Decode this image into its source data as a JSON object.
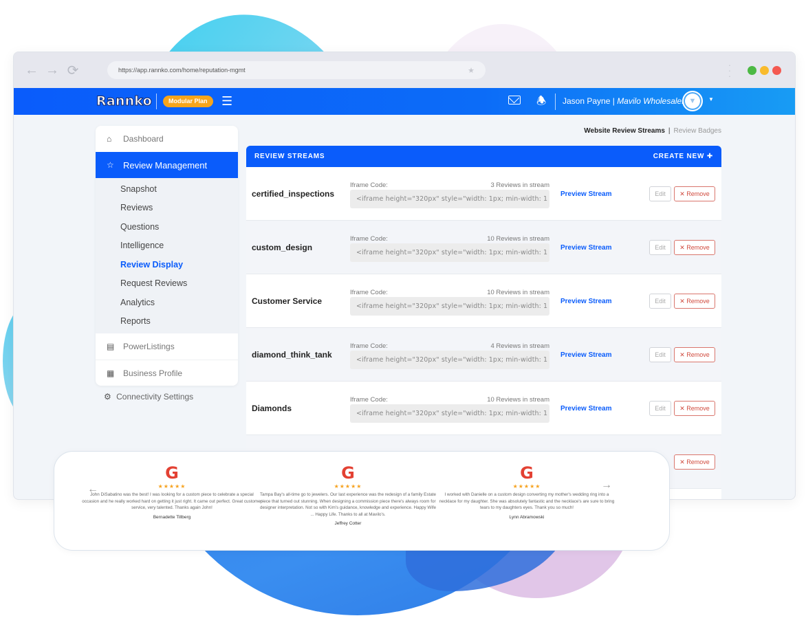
{
  "browser": {
    "url": "https://app.rannko.com/home/reputation-mgmt",
    "traffic_colors": [
      "#4cb944",
      "#f9bb2d",
      "#f45951"
    ]
  },
  "appbar": {
    "logo": "Rannko",
    "plan": "Modular Plan",
    "user": "Jason Payne",
    "separator": " | ",
    "company": "Mavilo Wholesalers"
  },
  "sidebar": {
    "dashboard": "Dashboard",
    "review_management": "Review Management",
    "sub_items": [
      {
        "label": "Snapshot"
      },
      {
        "label": "Reviews"
      },
      {
        "label": "Questions"
      },
      {
        "label": "Intelligence"
      },
      {
        "label": "Review Display"
      },
      {
        "label": "Request Reviews"
      },
      {
        "label": "Analytics"
      },
      {
        "label": "Reports"
      }
    ],
    "powerlistings": "PowerListings",
    "business_profile": "Business Profile",
    "connectivity": "Connectivity Settings"
  },
  "tabs": {
    "active": "Website Review Streams",
    "other": "Review Badges"
  },
  "panel": {
    "title": "REVIEW STREAMS",
    "create_new": "CREATE NEW",
    "iframe_label": "Iframe Code:",
    "iframe_code": "<iframe height=\"320px\" style=\"width: 1px; min-width: 1",
    "preview_label": "Preview Stream",
    "edit_label": "Edit",
    "remove_label": "Remove",
    "streams": [
      {
        "name": "certified_inspections",
        "count": "3 Reviews in stream"
      },
      {
        "name": "custom_design",
        "count": "10 Reviews in stream"
      },
      {
        "name": "Customer Service",
        "count": "10 Reviews in stream"
      },
      {
        "name": "diamond_think_tank",
        "count": "4 Reviews in stream"
      },
      {
        "name": "Diamonds",
        "count": "10 Reviews in stream"
      }
    ]
  },
  "widget": {
    "reviews": [
      {
        "source": "G",
        "stars": "★★★★★",
        "text": "John DiSabatino was the best! I was looking for a custom piece to celebrate a special occasion and he really worked hard on getting it just right. It came out perfect. Great customer service, very talented. Thanks again John!",
        "author": "Bernadette Tillberg"
      },
      {
        "source": "G",
        "stars": "★★★★★",
        "text": "Tampa Bay's all-time go to jewelers. Our last experience was the redesign of a family Estate piece that turned out stunning. When designing a commission piece there's always room for designer interpretation. Not so with Kim's guidance, knowledge and experience. Happy Wife ... Happy Life. Thanks to all at Mavilo's.",
        "author": "Jeffrey Cotter"
      },
      {
        "source": "G",
        "stars": "★★★★★",
        "text": "I worked with Danielle on a custom design converting my mother's wedding ring into a necklace for my daughter. She was absolutely fantastic and the necklace's are sure to bring tears to my daughters eyes. Thank you so much!",
        "author": "Lynn Abramowski"
      }
    ]
  }
}
